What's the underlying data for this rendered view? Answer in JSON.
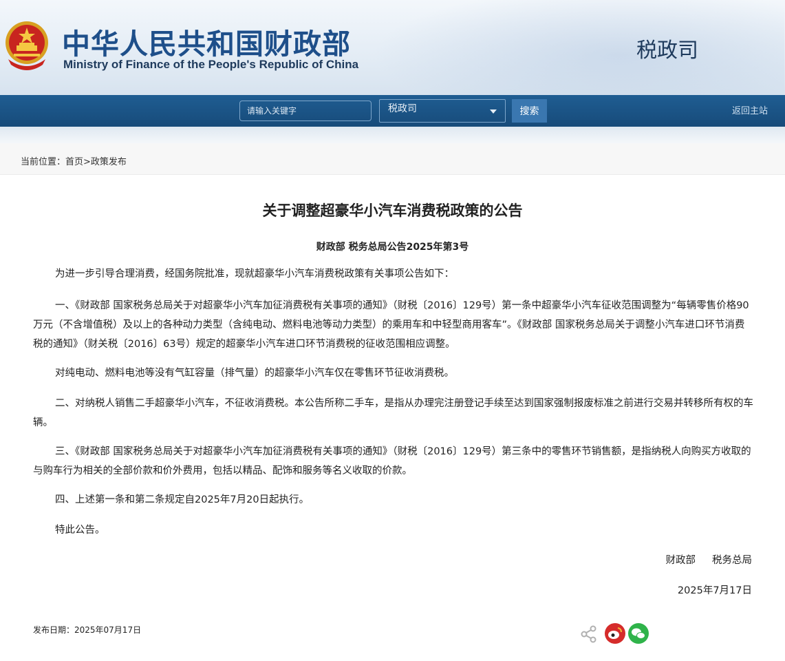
{
  "header": {
    "title_cn": "中华人民共和国财政部",
    "title_en": "Ministry of Finance of the People's Republic of China",
    "department": "税政司"
  },
  "nav": {
    "search_placeholder": "请输入关键字",
    "scope_selected": "税政司",
    "search_button": "搜索",
    "home_link": "返回主站"
  },
  "breadcrumb": "当前位置：首页>政策发布",
  "article": {
    "title": "关于调整超豪华小汽车消费税政策的公告",
    "doc_number": "财政部 税务总局公告2025年第3号",
    "paragraphs": [
      "为进一步引导合理消费，经国务院批准，现就超豪华小汽车消费税政策有关事项公告如下：",
      "一、《财政部 国家税务总局关于对超豪华小汽车加征消费税有关事项的通知》（财税〔2016〕129号）第一条中超豪华小汽车征收范围调整为“每辆零售价格90万元（不含增值税）及以上的各种动力类型（含纯电动、燃料电池等动力类型）的乘用车和中轻型商用客车”。《财政部 国家税务总局关于调整小汽车进口环节消费税的通知》（财关税〔2016〕63号）规定的超豪华小汽车进口环节消费税的征收范围相应调整。",
      "对纯电动、燃料电池等没有气缸容量（排气量）的超豪华小汽车仅在零售环节征收消费税。",
      "二、对纳税人销售二手超豪华小汽车，不征收消费税。本公告所称二手车，是指从办理完注册登记手续至达到国家强制报废标准之前进行交易并转移所有权的车辆。",
      "三、《财政部 国家税务总局关于对超豪华小汽车加征消费税有关事项的通知》（财税〔2016〕129号）第三条中的零售环节销售额，是指纳税人向购买方收取的与购车行为相关的全部价款和价外费用，包括以精品、配饰和服务等名义收取的价款。",
      "四、上述第一条和第二条规定自2025年7月20日起执行。",
      "特此公告。"
    ],
    "signers": [
      "财政部",
      "税务总局"
    ],
    "sign_date": "2025年7月17日",
    "publish_date": "发布日期：2025年07月17日"
  },
  "share": {
    "icons": [
      "share-icon",
      "weibo-icon",
      "wechat-icon"
    ],
    "colors": {
      "weibo": "#d52c2b",
      "wechat": "#2fb34a",
      "share": "#b0b0b0"
    }
  }
}
